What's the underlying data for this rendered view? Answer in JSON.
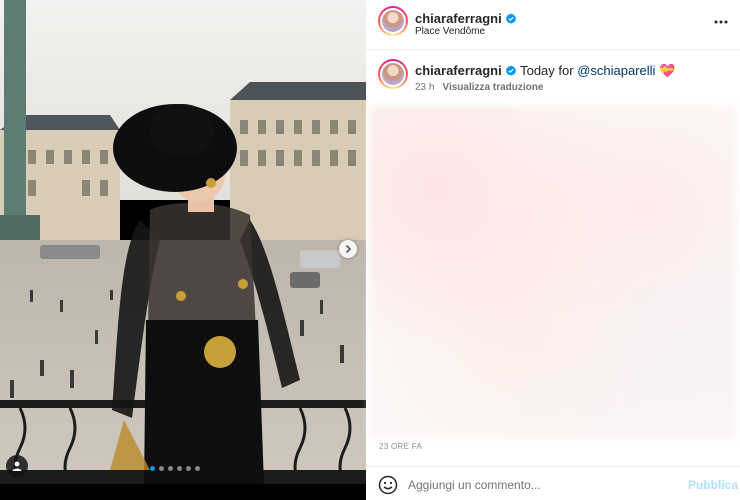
{
  "post": {
    "author": {
      "username": "chiaraferragni",
      "verified": true,
      "location": "Place Vendôme"
    },
    "caption": {
      "username": "chiaraferragni",
      "text": "Today for",
      "mention": "@schiaparelli",
      "emoji": "💝",
      "time": "23 h",
      "see_translation_label": "Visualizza traduzione"
    },
    "timestamp_label": "23 ORE FA",
    "carousel": {
      "slide_count": 6,
      "active_slide": 1
    }
  },
  "comment_box": {
    "placeholder": "Aggiungi un commento...",
    "publish_label": "Pubblica"
  },
  "colors": {
    "accent_blue": "#0095f6",
    "mention_blue": "#00376b",
    "publish_disabled": "#b2dffc",
    "verified_blue": "#0095f6"
  },
  "icons": {
    "more": "more-horizontal-icon",
    "next": "chevron-right-icon",
    "tags": "user-tag-icon",
    "emoji": "smiley-icon",
    "verified": "verified-badge-icon"
  }
}
